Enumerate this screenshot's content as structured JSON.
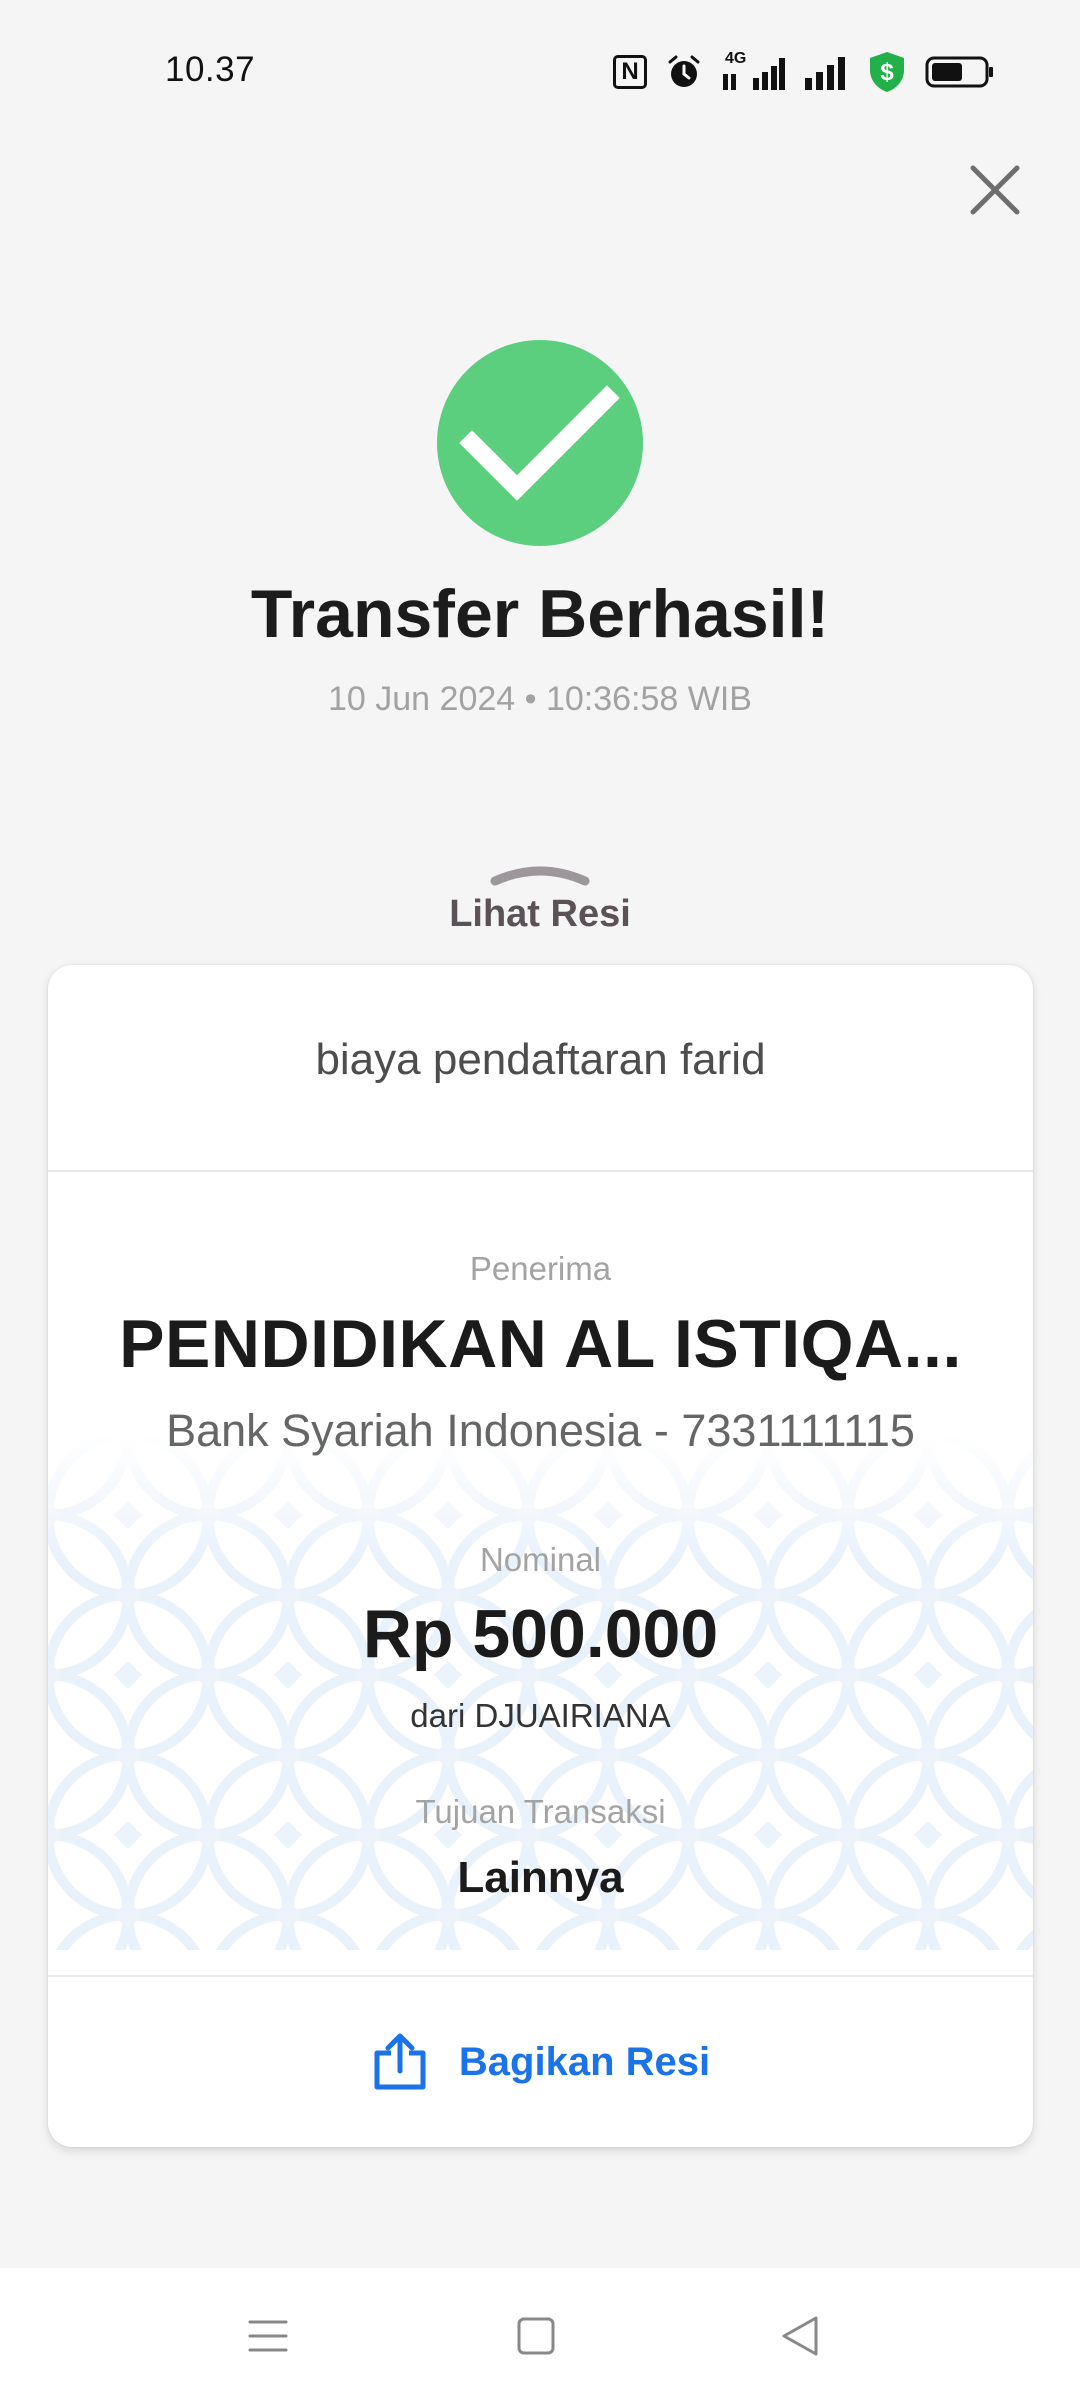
{
  "status_bar": {
    "time": "10.37",
    "icons": [
      "nfc-icon",
      "alarm-icon",
      "4g-signal-icon",
      "signal-icon",
      "security-shield-icon",
      "battery-icon"
    ],
    "network_label": "4G"
  },
  "header": {
    "title": "Transfer Berhasil!",
    "datetime": "10 Jun 2024 • 10:36:58 WIB",
    "success_color": "#5ccf7f"
  },
  "receipt_toggle": {
    "label": "Lihat Resi"
  },
  "receipt": {
    "note": "biaya pendaftaran farid",
    "recipient_label": "Penerima",
    "recipient_name": "PENDIDIKAN AL ISTIQA...",
    "recipient_bank": "Bank Syariah Indonesia - 7331111115",
    "amount_label": "Nominal",
    "amount": "Rp 500.000",
    "sender": "dari DJUAIRIANA",
    "purpose_label": "Tujuan Transaksi",
    "purpose": "Lainnya",
    "share_label": "Bagikan Resi",
    "accent_color": "#1a73e8"
  },
  "nav_bar": {
    "items": [
      "menu-icon",
      "home-icon",
      "back-icon"
    ]
  }
}
